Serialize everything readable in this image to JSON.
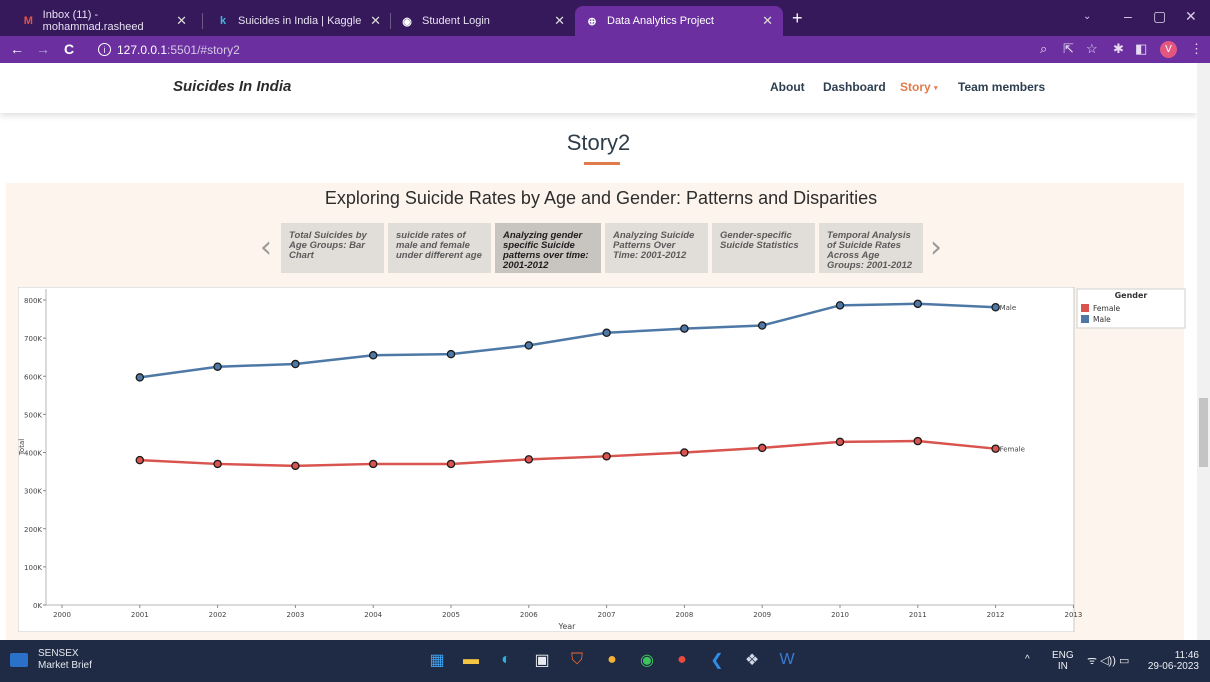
{
  "browser": {
    "tabs": [
      {
        "label": "Inbox (11) - mohammad.rasheed",
        "icon": "gmail-icon"
      },
      {
        "label": "Suicides in India | Kaggle",
        "icon": "kaggle-icon"
      },
      {
        "label": "Student Login",
        "icon": "globe-icon"
      },
      {
        "label": "Data Analytics Project",
        "icon": "globe-icon"
      }
    ],
    "url_host": "127.0.0.1",
    "url_path": ":5501/#story2",
    "avatar_letter": "V"
  },
  "site": {
    "brand": "Suicides In India",
    "nav": [
      "About",
      "Dashboard",
      "Story",
      "Team members"
    ],
    "accent": "#e07c4c"
  },
  "story": {
    "title": "Story2",
    "viz_title": "Exploring Suicide Rates by Age and Gender: Patterns and Disparities",
    "points": [
      "Total Suicides by Age Groups: Bar Chart",
      "suicide rates of male and female under different age",
      "Analyzing gender specific Suicide patterns over time: 2001-2012",
      "Analyzing Suicide Patterns Over Time: 2001-2012",
      "Gender-specific Suicide Statistics",
      "Temporal Analysis of Suicide Rates Across Age Groups: 2001-2012"
    ],
    "selected_point": 2
  },
  "chart_data": {
    "type": "line",
    "x": [
      2001,
      2002,
      2003,
      2004,
      2005,
      2006,
      2007,
      2008,
      2009,
      2010,
      2011,
      2012
    ],
    "xlim": [
      2000,
      2013
    ],
    "x_ticks": [
      "2000",
      "2001",
      "2002",
      "2003",
      "2004",
      "2005",
      "2006",
      "2007",
      "2008",
      "2009",
      "2010",
      "2011",
      "2012",
      "2013"
    ],
    "ylim": [
      0,
      800000
    ],
    "y_ticks": [
      "0K",
      "100K",
      "200K",
      "300K",
      "400K",
      "500K",
      "600K",
      "700K",
      "800K"
    ],
    "xlabel": "Year",
    "ylabel": "Total",
    "legend_title": "Gender",
    "legend_position": "right",
    "series": [
      {
        "name": "Female",
        "color": "#d9534f",
        "end_label": "Female",
        "values": [
          380000,
          370000,
          365000,
          370000,
          370000,
          382000,
          390000,
          400000,
          412000,
          428000,
          430000,
          410000
        ]
      },
      {
        "name": "Male",
        "color": "#4e79a7",
        "end_label": "Male",
        "values": [
          597000,
          625000,
          632000,
          655000,
          658000,
          681000,
          714000,
          725000,
          733000,
          786000,
          790000,
          781000
        ]
      }
    ]
  },
  "taskbar": {
    "widget_title": "SENSEX",
    "widget_sub": "Market Brief",
    "lang_top": "ENG",
    "lang_bottom": "IN",
    "time": "11:46",
    "date": "29-06-2023"
  }
}
